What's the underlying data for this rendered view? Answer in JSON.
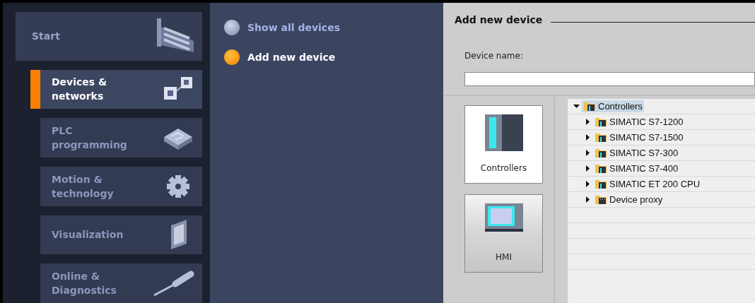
{
  "sidebar": {
    "start": {
      "label": "Start"
    },
    "items": [
      {
        "label": "Devices & networks",
        "selected": true
      },
      {
        "label": "PLC programming",
        "selected": false
      },
      {
        "label": "Motion & technology",
        "selected": false
      },
      {
        "label": "Visualization",
        "selected": false
      },
      {
        "label": "Online & Diagnostics",
        "selected": false
      }
    ]
  },
  "actions": [
    {
      "label": "Show all devices",
      "selected": false
    },
    {
      "label": "Add new device",
      "selected": true
    }
  ],
  "panel": {
    "title": "Add new device",
    "device_name_label": "Device name:",
    "categories": [
      {
        "label": "Controllers",
        "selected": true
      },
      {
        "label": "HMI",
        "selected": false
      }
    ],
    "tree": [
      {
        "label": "Controllers",
        "expanded": true,
        "selected": true,
        "children": [
          {
            "label": "SIMATIC S7-1200",
            "expanded": false,
            "selected": false
          },
          {
            "label": "SIMATIC S7-1500",
            "expanded": false,
            "selected": false
          },
          {
            "label": "SIMATIC S7-300",
            "expanded": false,
            "selected": false
          },
          {
            "label": "SIMATIC S7-400",
            "expanded": false,
            "selected": false
          },
          {
            "label": "SIMATIC ET 200 CPU",
            "expanded": false,
            "selected": false
          },
          {
            "label": "Device proxy",
            "expanded": false,
            "selected": false
          }
        ]
      }
    ]
  }
}
